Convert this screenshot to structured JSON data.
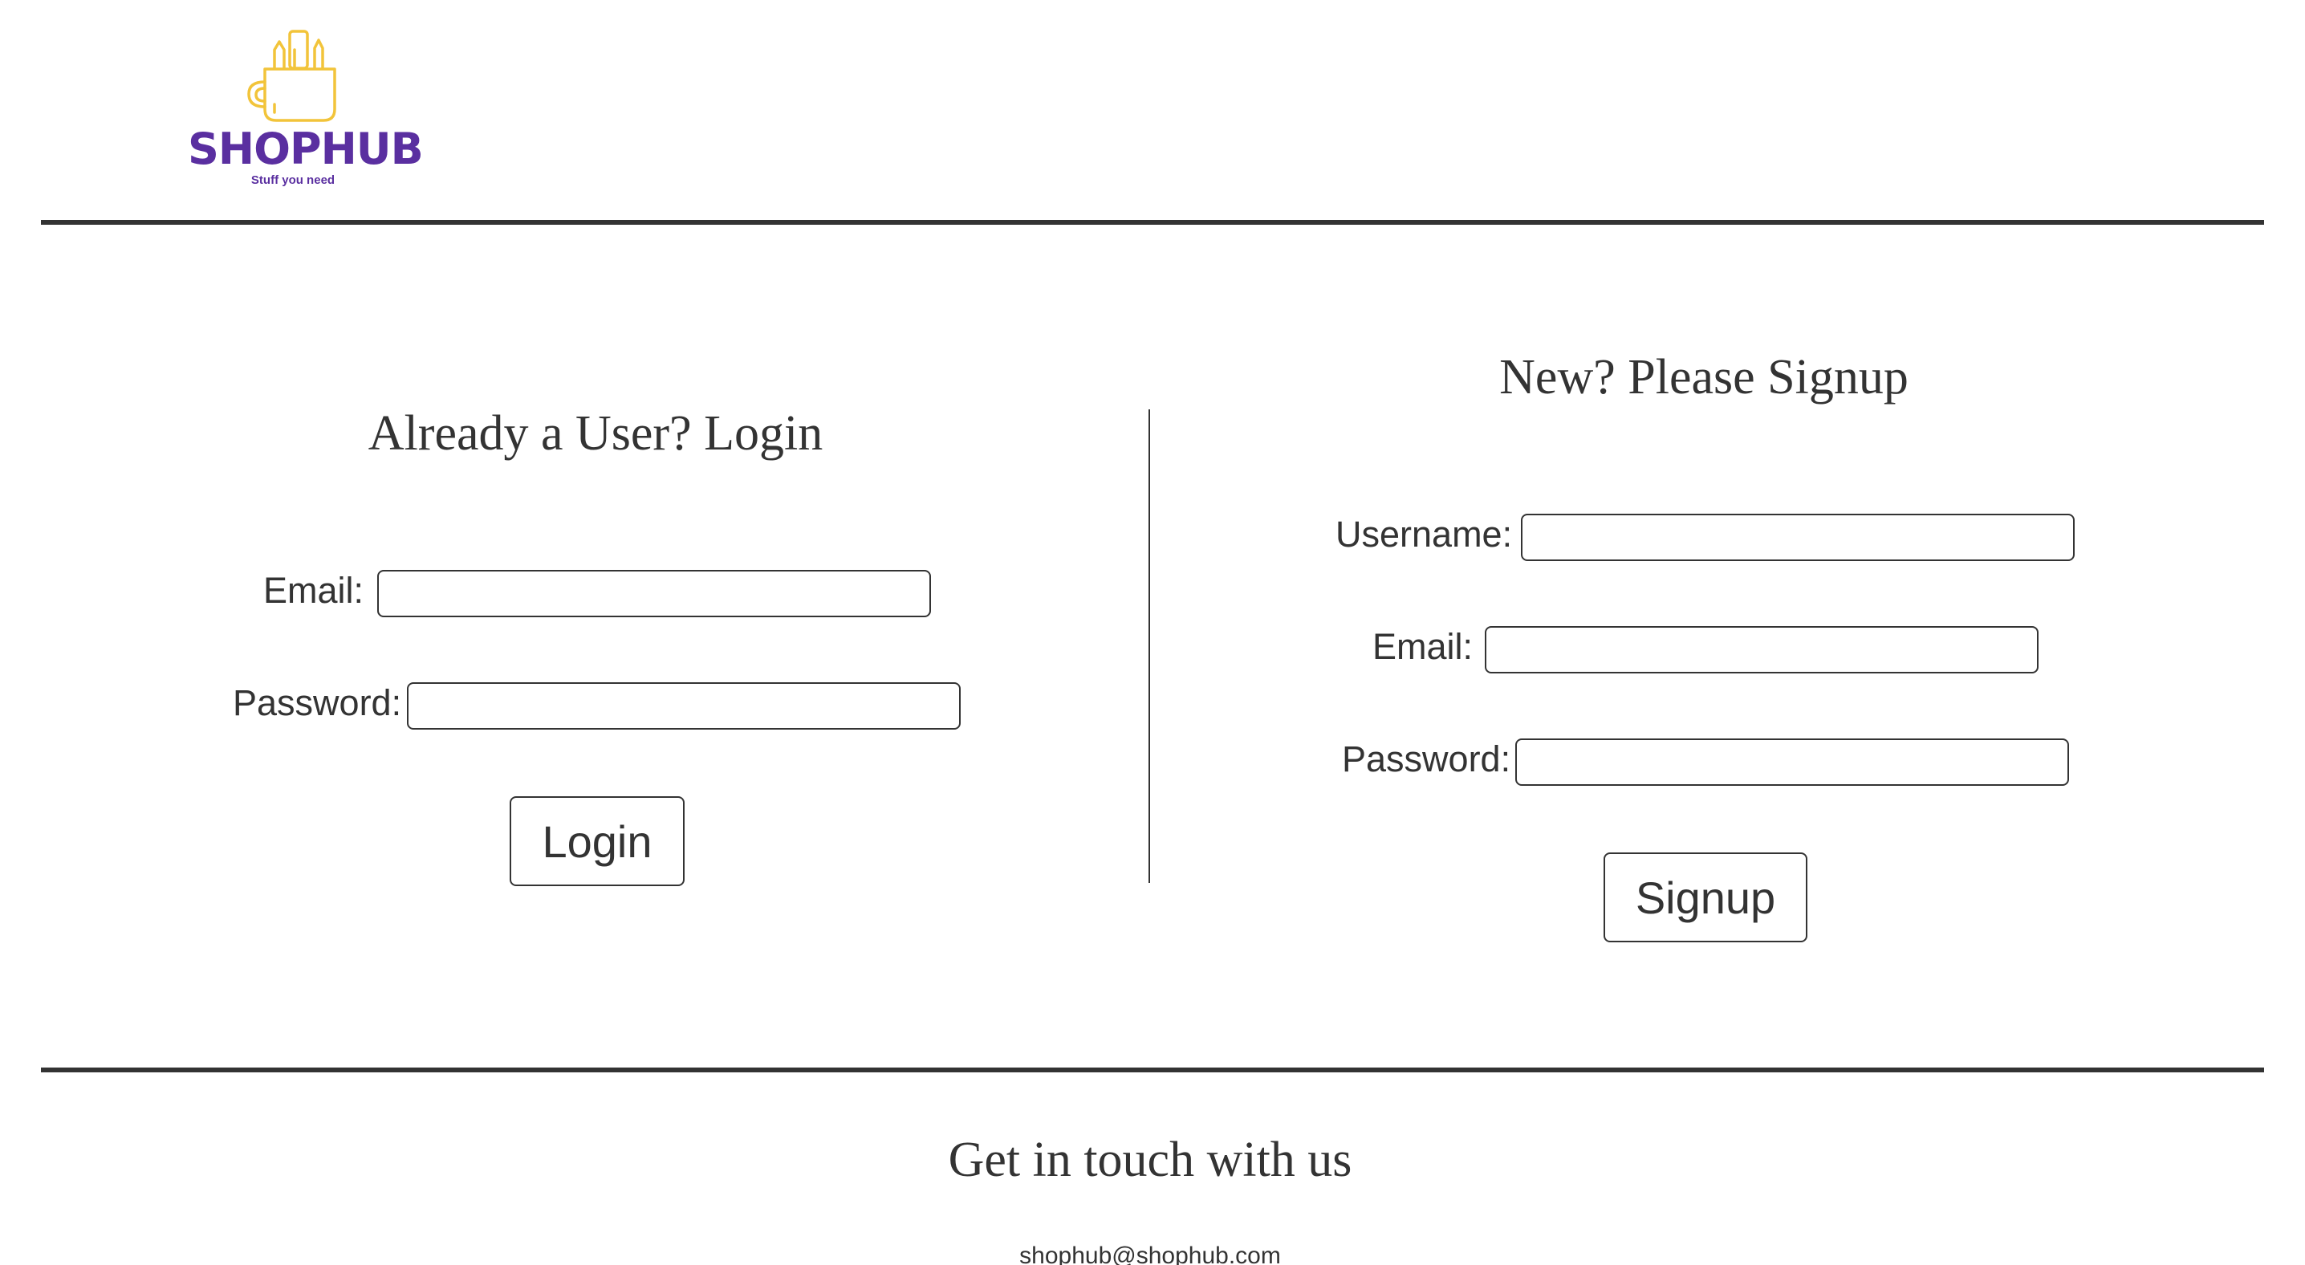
{
  "brand": {
    "name": "SHOPHUB",
    "tagline": "Stuff you need",
    "primary_color": "#5a2fa0",
    "icon_color": "#f2c43a",
    "icon": "mug-with-pencils-icon"
  },
  "login": {
    "heading": "Already a User? Login",
    "email_label": "Email:",
    "email_value": "",
    "password_label": "Password:",
    "password_value": "",
    "button_label": "Login"
  },
  "signup": {
    "heading": "New? Please Signup",
    "username_label": "Username:",
    "username_value": "",
    "email_label": "Email:",
    "email_value": "",
    "password_label": "Password:",
    "password_value": "",
    "button_label": "Signup"
  },
  "footer": {
    "heading": "Get in touch with us",
    "email": "shophub@shophub.com"
  },
  "colors": {
    "text": "#333333",
    "divider": "#333333",
    "background": "#ffffff"
  }
}
